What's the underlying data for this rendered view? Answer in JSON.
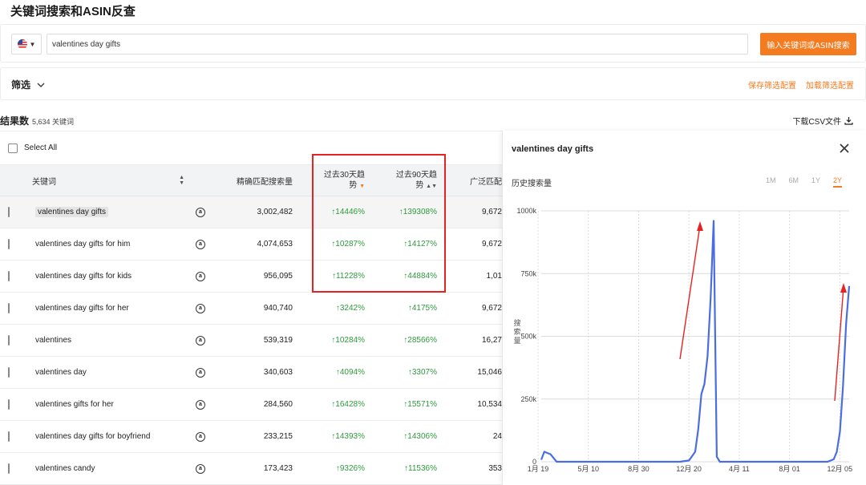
{
  "page": {
    "title": "关键词搜索和ASIN反查"
  },
  "search": {
    "value": "valentines day gifts",
    "button_label": "输入关键词或ASIN搜索"
  },
  "filter": {
    "label": "筛选",
    "save_label": "保存筛选配置",
    "load_label": "加载筛选配置"
  },
  "results": {
    "label": "结果数",
    "count": "5,634 关键词",
    "download_label": "下载CSV文件"
  },
  "table": {
    "select_all": "Select All",
    "headers": {
      "keyword": "关键词",
      "exact": "精确匹配搜索量",
      "trend30_a": "过去30天趋",
      "trend30_b": "势",
      "trend90_a": "过去90天趋",
      "trend90_b": "势",
      "broad": "广泛匹配"
    },
    "rows": [
      {
        "keyword": "valentines day gifts",
        "exact": "3,002,482",
        "t30": "↑14446%",
        "t90": "↑139308%",
        "broad": "9,672"
      },
      {
        "keyword": "valentines day gifts for him",
        "exact": "4,074,653",
        "t30": "↑10287%",
        "t90": "↑14127%",
        "broad": "9,672"
      },
      {
        "keyword": "valentines day gifts for kids",
        "exact": "956,095",
        "t30": "↑11228%",
        "t90": "↑44884%",
        "broad": "1,01"
      },
      {
        "keyword": "valentines day gifts for her",
        "exact": "940,740",
        "t30": "↑3242%",
        "t90": "↑4175%",
        "broad": "9,672"
      },
      {
        "keyword": "valentines",
        "exact": "539,319",
        "t30": "↑10284%",
        "t90": "↑28566%",
        "broad": "16,27"
      },
      {
        "keyword": "valentines day",
        "exact": "340,603",
        "t30": "↑4094%",
        "t90": "↑3307%",
        "broad": "15,046"
      },
      {
        "keyword": "valentines gifts for her",
        "exact": "284,560",
        "t30": "↑16428%",
        "t90": "↑15571%",
        "broad": "10,534"
      },
      {
        "keyword": "valentines day gifts for boyfriend",
        "exact": "233,215",
        "t30": "↑14393%",
        "t90": "↑14306%",
        "broad": "24"
      },
      {
        "keyword": "valentines candy",
        "exact": "173,423",
        "t30": "↑9326%",
        "t90": "↑11536%",
        "broad": "353"
      }
    ]
  },
  "panel": {
    "title": "valentines day gifts",
    "history_label": "历史搜索量",
    "ranges": [
      "1M",
      "6M",
      "1Y",
      "2Y"
    ],
    "active_range": "2Y"
  },
  "colors": {
    "accent": "#f47b20",
    "up": "#2e9a3e",
    "line": "#4a6ee0",
    "annotation": "#e62222"
  },
  "chart_data": {
    "type": "line",
    "ylabel": "搜索量",
    "ylim": [
      0,
      1000000
    ],
    "yticks": [
      "0",
      "250k",
      "500k",
      "750k",
      "1000k"
    ],
    "xticks": [
      "1月 19",
      "5月 10",
      "8月 30",
      "12月 20",
      "4月 11",
      "8月 01",
      "12月 05"
    ],
    "series": [
      {
        "x": [
          0,
          0.01,
          0.03,
          0.05,
          0.1,
          0.3,
          0.45,
          0.48,
          0.5,
          0.51,
          0.52,
          0.53,
          0.54,
          0.55,
          0.56,
          0.57,
          0.58,
          0.6,
          0.8,
          0.93,
          0.95,
          0.96,
          0.97,
          0.98,
          0.99,
          1.0
        ],
        "values": [
          8000,
          40000,
          30000,
          0,
          0,
          0,
          0,
          5000,
          40000,
          130000,
          270000,
          310000,
          420000,
          650000,
          960000,
          20000,
          0,
          0,
          0,
          0,
          10000,
          40000,
          120000,
          300000,
          550000,
          700000
        ]
      }
    ]
  }
}
